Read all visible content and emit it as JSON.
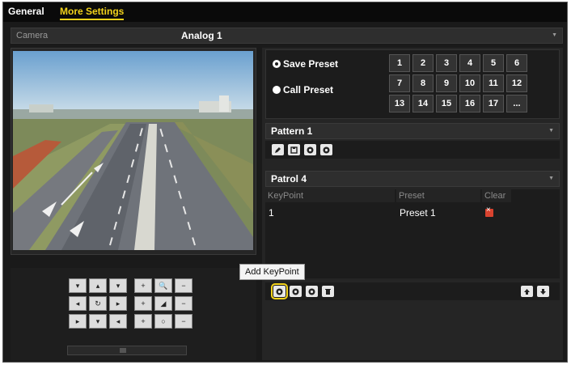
{
  "tabs": [
    {
      "label": "General"
    },
    {
      "label": "More Settings"
    }
  ],
  "camera": {
    "label": "Camera",
    "value": "Analog 1"
  },
  "preset": {
    "save_label": "Save Preset",
    "call_label": "Call Preset",
    "selected": "save",
    "numbers": [
      "1",
      "2",
      "3",
      "4",
      "5",
      "6",
      "7",
      "8",
      "9",
      "10",
      "11",
      "12",
      "13",
      "14",
      "15",
      "16",
      "17",
      "..."
    ]
  },
  "pattern": {
    "value": "Pattern 1",
    "icons": [
      "edit-icon",
      "save-icon",
      "play-icon",
      "stop-icon"
    ]
  },
  "patrol": {
    "value": "Patrol 4",
    "columns": [
      "KeyPoint",
      "Preset",
      "Clear"
    ],
    "rows": [
      {
        "keypoint": "1",
        "preset": "Preset 1"
      }
    ],
    "bottom_icons": [
      "add-keypoint-icon",
      "play-icon",
      "stop-icon",
      "trash-icon",
      "arrow-up-icon",
      "arrow-down-icon"
    ]
  },
  "tooltip": {
    "text": "Add KeyPoint"
  },
  "ptz": {
    "keys": [
      "▾",
      "▴",
      "▾",
      "+",
      "🔍",
      "−",
      "◂",
      "↻",
      "▸",
      "+",
      "◢",
      "−",
      "▸",
      "▾",
      "◂",
      "+",
      "○",
      "−"
    ]
  },
  "colors": {
    "accent": "#f2d21b",
    "panel": "#1a1a1a",
    "delete": "#d9432f"
  }
}
